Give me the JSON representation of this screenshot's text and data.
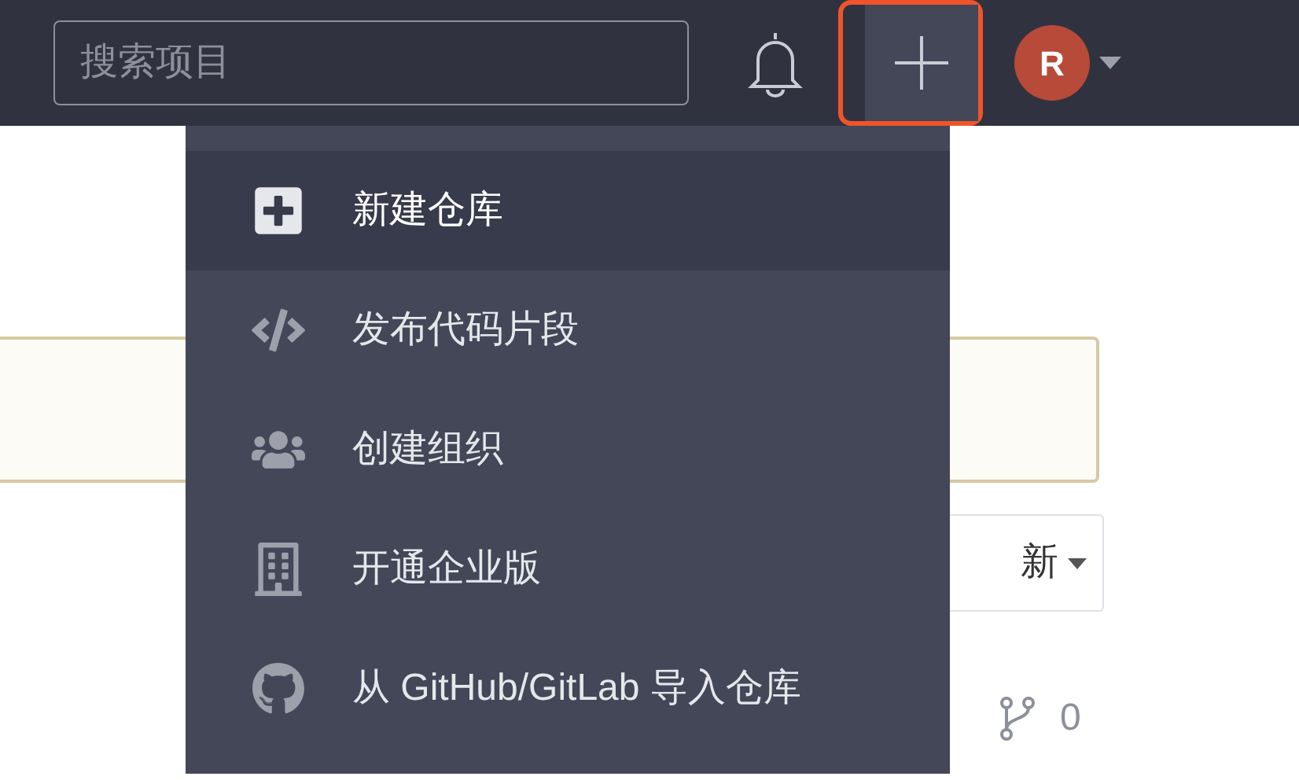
{
  "header": {
    "search": {
      "placeholder": "搜索项目"
    },
    "create_button": {
      "highlighted": true
    },
    "avatar": {
      "letter": "R"
    }
  },
  "create_menu": {
    "items": [
      {
        "kind": "repo",
        "label": "新建仓库",
        "selected": true
      },
      {
        "kind": "code",
        "label": "发布代码片段",
        "selected": false
      },
      {
        "kind": "org",
        "label": "创建组织",
        "selected": false
      },
      {
        "kind": "enterprise",
        "label": "开通企业版",
        "selected": false
      },
      {
        "kind": "import",
        "label": "从 GitHub/GitLab 导入仓库",
        "selected": false
      }
    ]
  },
  "sort_button": {
    "label": "新"
  },
  "forks": {
    "count": "0"
  }
}
